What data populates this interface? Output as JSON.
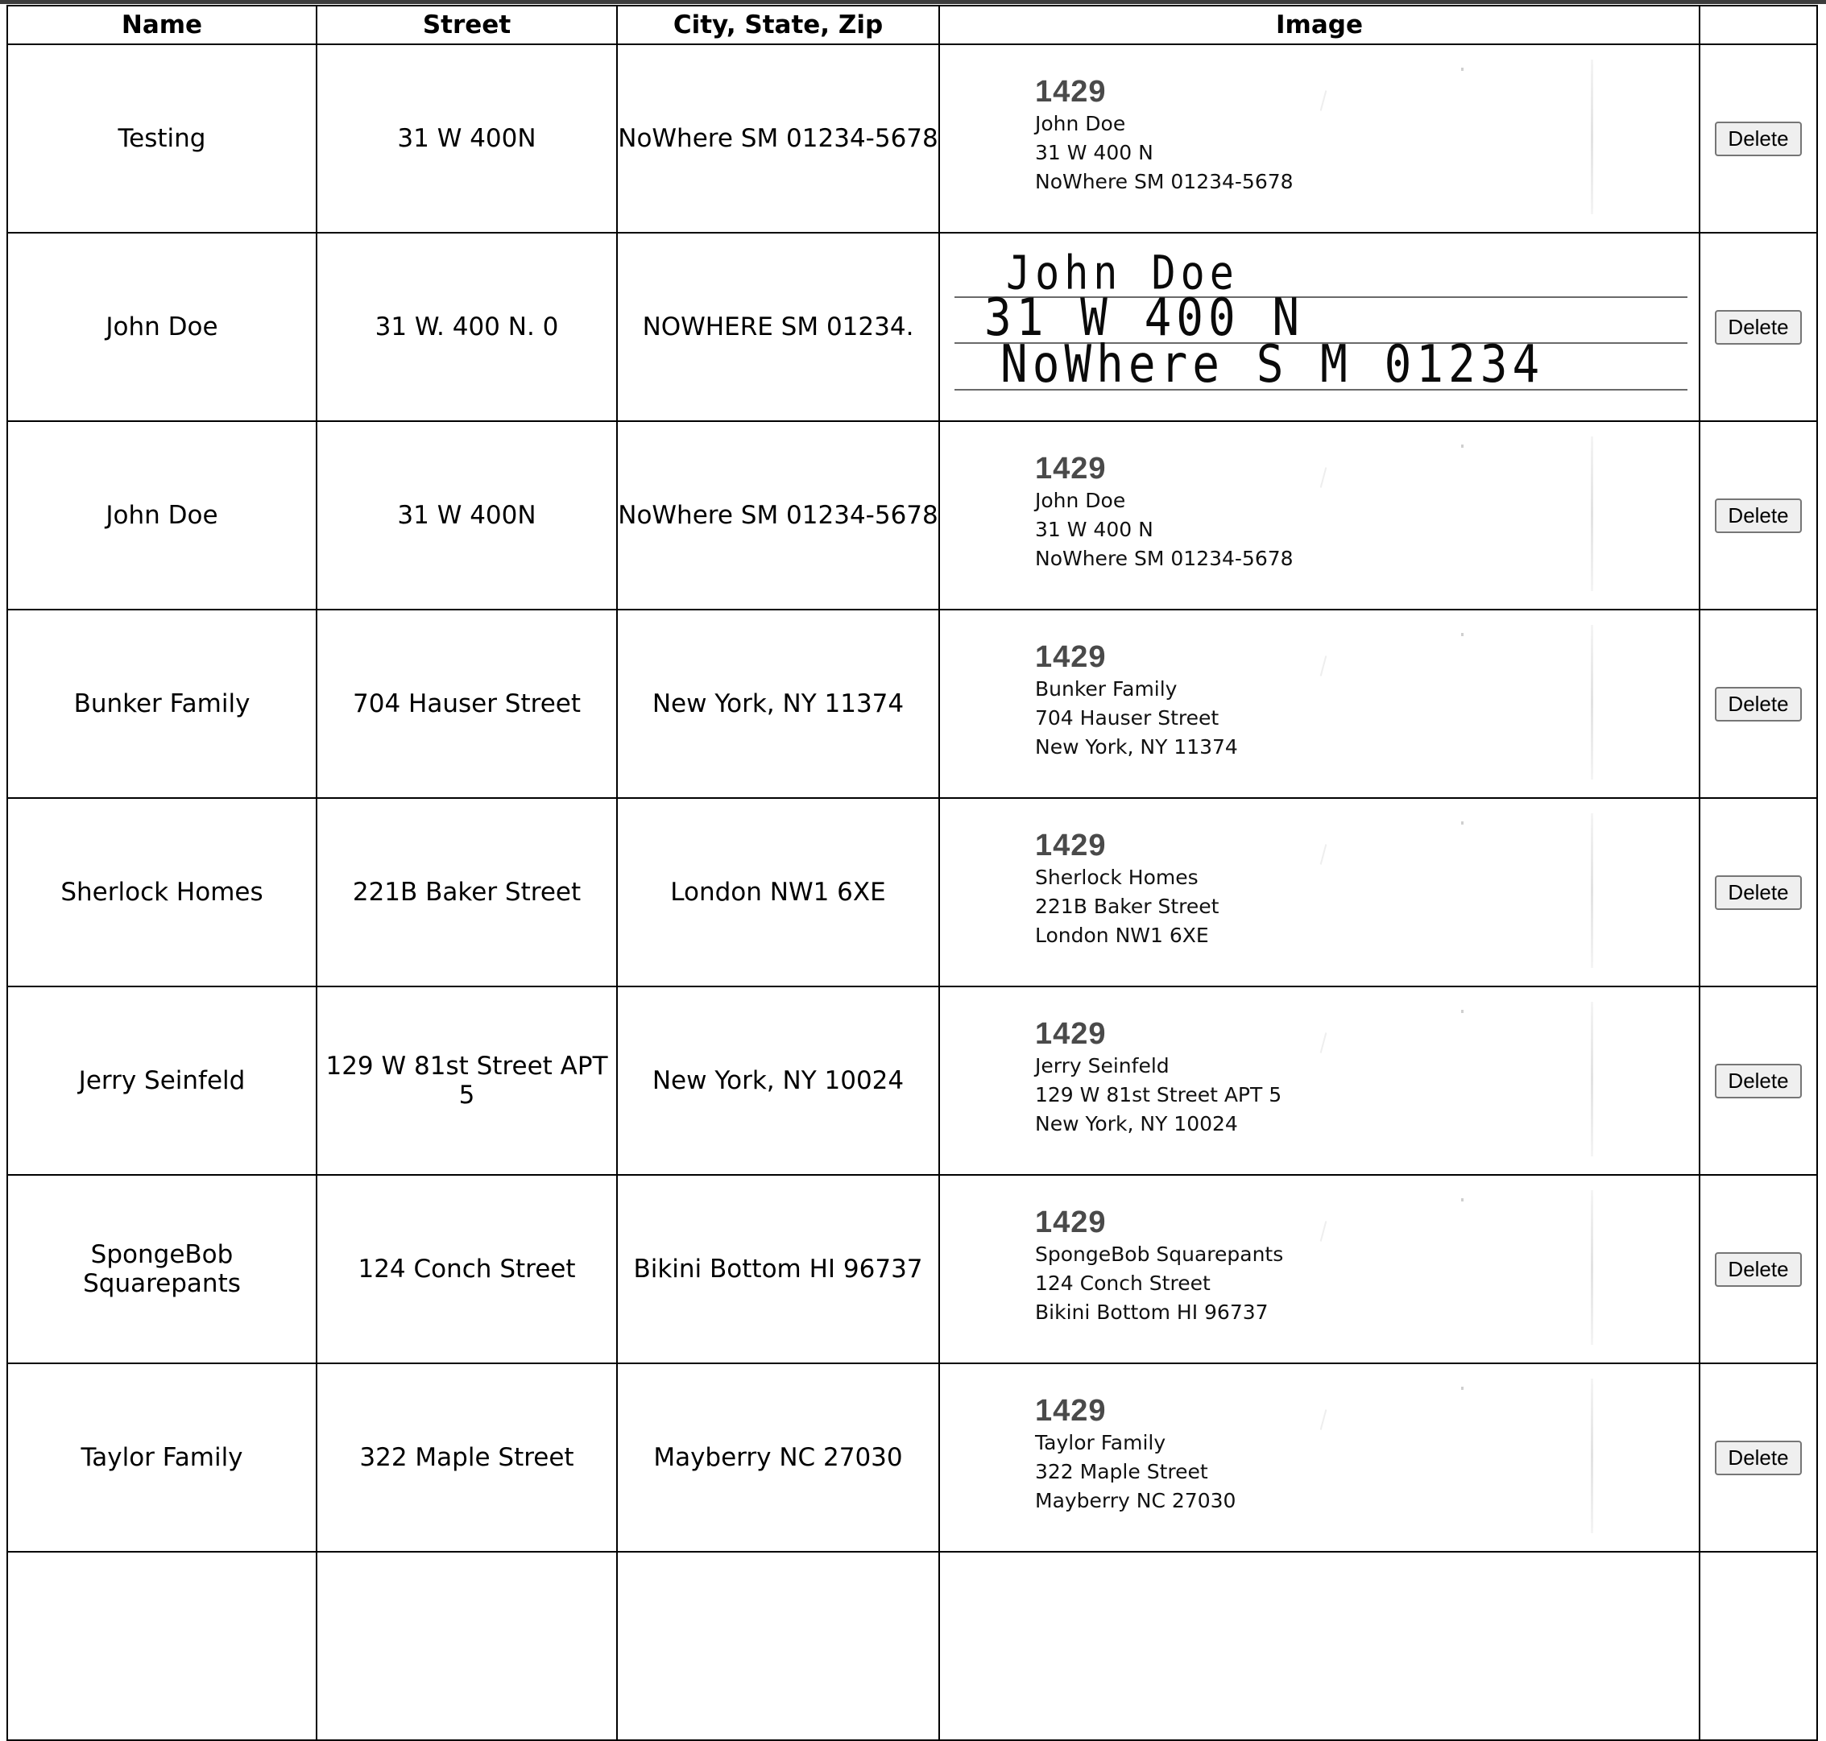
{
  "table": {
    "headers": [
      "Name",
      "Street",
      "City, State, Zip",
      "Image",
      ""
    ],
    "action_label": "Delete",
    "rows": [
      {
        "name": "Testing",
        "street": "31 W 400N",
        "city": "NoWhere SM 01234-5678",
        "image": {
          "kind": "printed",
          "number": "1429",
          "lines": [
            "John Doe",
            "31 W 400 N",
            "NoWhere SM 01234-5678"
          ]
        }
      },
      {
        "name": "John Doe",
        "street": "31 W. 400 N. 0",
        "city": "NOWHERE SM 01234.",
        "image": {
          "kind": "handwritten",
          "lines": [
            "John Doe",
            "31 W  400 N",
            "NoWhere  S M  01234"
          ]
        }
      },
      {
        "name": "John Doe",
        "street": "31 W 400N",
        "city": "NoWhere SM 01234-5678",
        "image": {
          "kind": "printed",
          "number": "1429",
          "lines": [
            "John Doe",
            "31 W 400 N",
            "NoWhere SM 01234-5678"
          ]
        }
      },
      {
        "name": "Bunker Family",
        "street": "704 Hauser Street",
        "city": "New York, NY 11374",
        "image": {
          "kind": "printed",
          "number": "1429",
          "lines": [
            "Bunker Family",
            "704 Hauser Street",
            "New York, NY 11374"
          ]
        }
      },
      {
        "name": "Sherlock Homes",
        "street": "221B Baker Street",
        "city": "London NW1 6XE",
        "image": {
          "kind": "printed",
          "number": "1429",
          "lines": [
            "Sherlock Homes",
            "221B Baker Street",
            "London NW1 6XE"
          ]
        }
      },
      {
        "name": "Jerry Seinfeld",
        "street": "129 W 81st Street APT 5",
        "city": "New York, NY 10024",
        "image": {
          "kind": "printed",
          "number": "1429",
          "lines": [
            "Jerry Seinfeld",
            "129 W 81st Street APT 5",
            "New York, NY 10024"
          ]
        }
      },
      {
        "name": "SpongeBob Squarepants",
        "street": "124 Conch Street",
        "city": "Bikini Bottom HI 96737",
        "image": {
          "kind": "printed",
          "number": "1429",
          "lines": [
            "SpongeBob Squarepants",
            "124 Conch Street",
            "Bikini Bottom HI 96737"
          ]
        }
      },
      {
        "name": "Taylor Family",
        "street": "322 Maple Street",
        "city": "Mayberry NC 27030",
        "image": {
          "kind": "printed",
          "number": "1429",
          "lines": [
            "Taylor Family",
            "322 Maple Street",
            "Mayberry NC 27030"
          ]
        }
      }
    ]
  }
}
